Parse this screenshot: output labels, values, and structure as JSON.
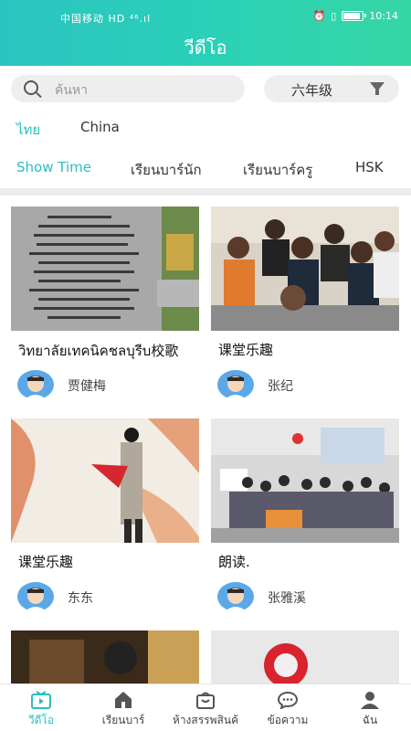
{
  "status_bar": {
    "carrier": "中国移动 HD ⁴⁶.ıl",
    "time": "10:14"
  },
  "header": {
    "title": "วีดีโอ"
  },
  "search": {
    "placeholder": "ค้นหา"
  },
  "grade_filter": {
    "value": "六年级"
  },
  "languages": [
    {
      "label": "ไทย",
      "active": true
    },
    {
      "label": "China",
      "active": false
    }
  ],
  "categories": [
    {
      "label": "Show Time",
      "active": true
    },
    {
      "label": "เรียนบาร์นัก",
      "active": false
    },
    {
      "label": "เรียนบาร์ครู",
      "active": false
    },
    {
      "label": "HSK",
      "active": false
    }
  ],
  "videos": [
    {
      "caption": "วิทยาลัยเทคนิคชลบุรีบ校歌",
      "author": "贾健梅",
      "thumb": "document-photo"
    },
    {
      "caption": "课堂乐趣",
      "author": "张纪",
      "thumb": "students-selfie"
    },
    {
      "caption": "课堂乐趣",
      "author": "东东",
      "thumb": "fan-portrait"
    },
    {
      "caption": "朗读.",
      "author": "张雅溪",
      "thumb": "classroom"
    },
    {
      "caption": "",
      "author": "",
      "thumb": "dark-room"
    },
    {
      "caption": "",
      "author": "",
      "thumb": "red-flower"
    }
  ],
  "tabbar": [
    {
      "label": "วีดีโอ",
      "icon": "video-icon",
      "active": true
    },
    {
      "label": "เรียนบาร์",
      "icon": "home-icon",
      "active": false
    },
    {
      "label": "ห้างสรรพสินค้",
      "icon": "shop-bag-icon",
      "active": false
    },
    {
      "label": "ข้อความ",
      "icon": "message-icon",
      "active": false
    },
    {
      "label": "ฉัน",
      "icon": "person-icon",
      "active": false
    }
  ],
  "colors": {
    "accent": "#2bbfc0",
    "header_start": "#2bc3c0",
    "header_end": "#35d6a4"
  }
}
